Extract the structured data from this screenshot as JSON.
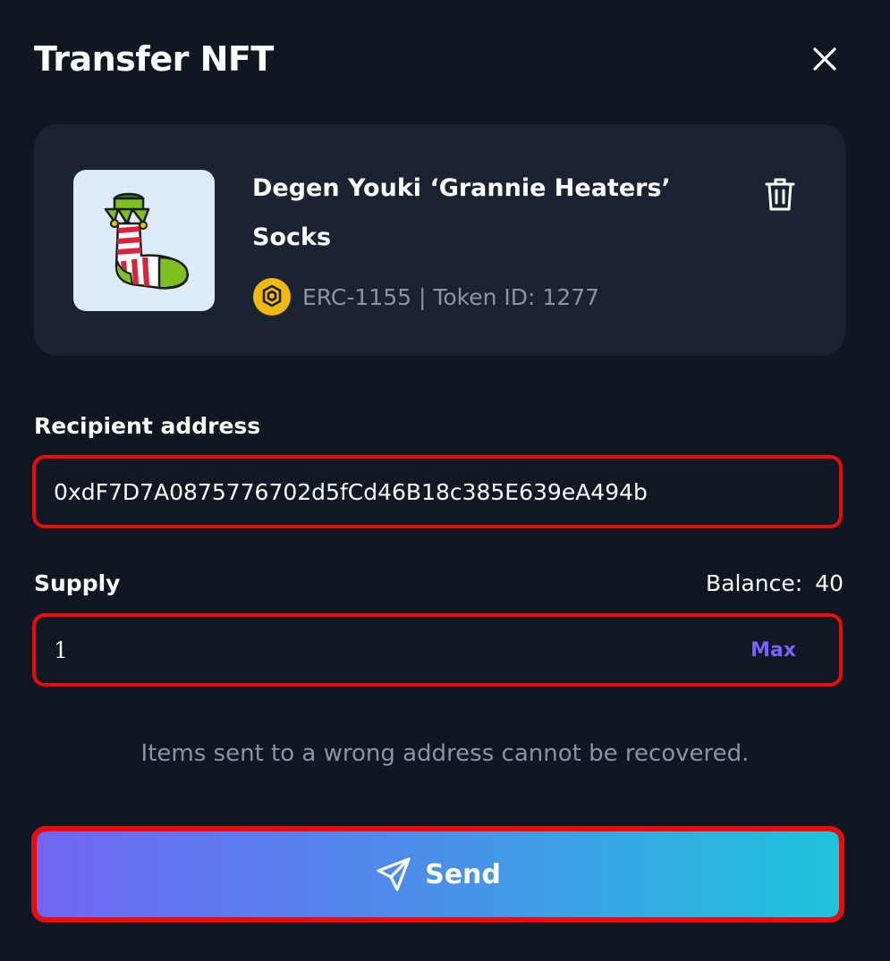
{
  "modal": {
    "title": "Transfer NFT"
  },
  "nft": {
    "name": "Degen Youki ‘Grannie Heaters’ Socks",
    "meta": "ERC-1155 | Token ID: 1277",
    "chain_icon": "bnb-chain-icon",
    "thumbnail_icon": "christmas-sock-icon"
  },
  "recipient": {
    "label": "Recipient address",
    "value": "0xdF7D7A0875776702d5fCd46B18c385E639eA494b"
  },
  "supply": {
    "label": "Supply",
    "value": "1",
    "max_label": "Max",
    "balance_label": "Balance:",
    "balance_value": "40"
  },
  "warning": "Items sent to a wrong address cannot be recovered.",
  "send": {
    "label": "Send",
    "icon": "send-icon"
  },
  "colors": {
    "background": "#101622",
    "card": "#1b2231",
    "accent": "#7b61ff",
    "highlight_border": "#ef0a0a",
    "gradient_start": "#7066f2",
    "gradient_end": "#1ec4dc"
  }
}
